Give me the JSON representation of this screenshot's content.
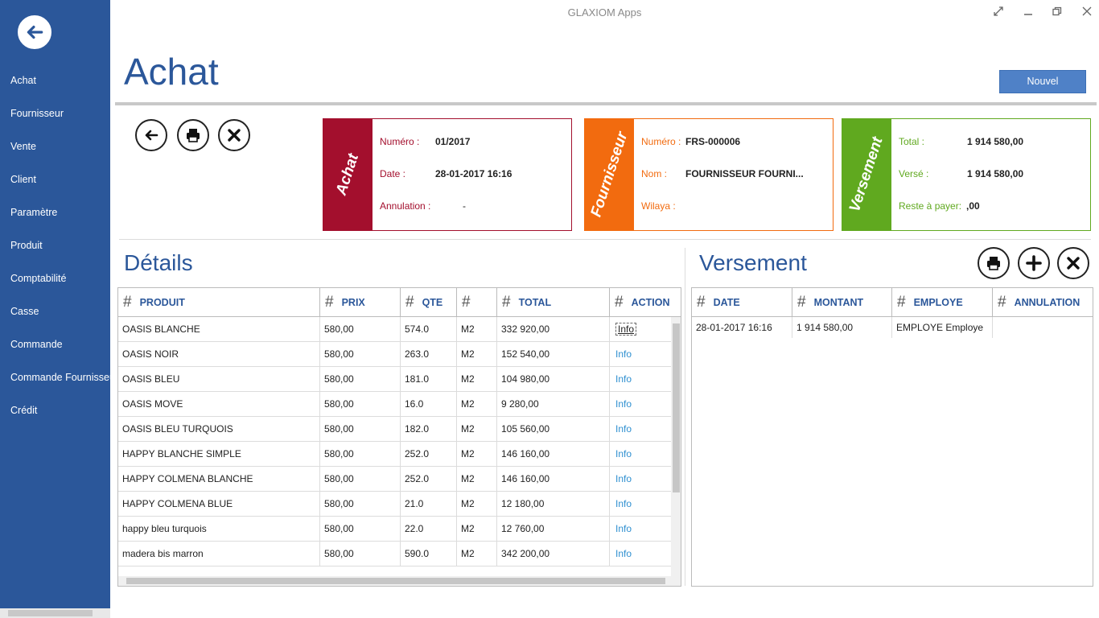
{
  "app": {
    "title": "GLAXIOM Apps"
  },
  "sidebar": {
    "items": [
      {
        "label": "Achat"
      },
      {
        "label": "Fournisseur"
      },
      {
        "label": "Vente"
      },
      {
        "label": "Client"
      },
      {
        "label": "Paramètre"
      },
      {
        "label": "Produit"
      },
      {
        "label": "Comptabilité"
      },
      {
        "label": "Casse"
      },
      {
        "label": "Commande"
      },
      {
        "label": "Commande Fournisseur"
      },
      {
        "label": "Crédit"
      }
    ]
  },
  "header": {
    "title": "Achat",
    "new_button": "Nouvel"
  },
  "cards": {
    "achat": {
      "side": "Achat",
      "numero_label": "Numéro :",
      "numero": "01/2017",
      "date_label": "Date :",
      "date": "28-01-2017 16:16",
      "annulation_label": "Annulation :",
      "annulation": "-",
      "color": "#a30f2d"
    },
    "fournisseur": {
      "side": "Fournisseur",
      "numero_label": "Numéro :",
      "numero": "FRS-000006",
      "nom_label": "Nom :",
      "nom": "FOURNISSEUR FOURNI...",
      "wilaya_label": "Wilaya :",
      "color": "#f26b0f"
    },
    "versement": {
      "side": "Versement",
      "total_label": "Total :",
      "total": "1 914 580,00",
      "verse_label": "Versé :",
      "verse": "1 914 580,00",
      "reste_label": "Reste à payer:",
      "reste": ",00",
      "color": "#60a91f"
    }
  },
  "details": {
    "title": "Détails",
    "columns": [
      "PRODUIT",
      "PRIX",
      "QTE",
      "",
      "TOTAL",
      "ACTION"
    ],
    "rows": [
      {
        "produit": "OASIS BLANCHE",
        "prix": "580,00",
        "qte": "574.0",
        "unit": "M2",
        "total": "332 920,00",
        "action": "Info"
      },
      {
        "produit": "OASIS NOIR",
        "prix": "580,00",
        "qte": "263.0",
        "unit": "M2",
        "total": "152 540,00",
        "action": "Info"
      },
      {
        "produit": "OASIS BLEU",
        "prix": "580,00",
        "qte": "181.0",
        "unit": "M2",
        "total": "104 980,00",
        "action": "Info"
      },
      {
        "produit": "OASIS MOVE",
        "prix": "580,00",
        "qte": "16.0",
        "unit": "M2",
        "total": "9 280,00",
        "action": "Info"
      },
      {
        "produit": "OASIS BLEU TURQUOIS",
        "prix": "580,00",
        "qte": "182.0",
        "unit": "M2",
        "total": "105 560,00",
        "action": "Info"
      },
      {
        "produit": "HAPPY BLANCHE SIMPLE",
        "prix": "580,00",
        "qte": "252.0",
        "unit": "M2",
        "total": "146 160,00",
        "action": "Info"
      },
      {
        "produit": "HAPPY COLMENA BLANCHE",
        "prix": "580,00",
        "qte": "252.0",
        "unit": "M2",
        "total": "146 160,00",
        "action": "Info"
      },
      {
        "produit": "HAPPY COLMENA BLUE",
        "prix": "580,00",
        "qte": "21.0",
        "unit": "M2",
        "total": "12 180,00",
        "action": "Info"
      },
      {
        "produit": "happy bleu turquois",
        "prix": "580,00",
        "qte": "22.0",
        "unit": "M2",
        "total": "12 760,00",
        "action": "Info"
      },
      {
        "produit": "madera bis marron",
        "prix": "580,00",
        "qte": "590.0",
        "unit": "M2",
        "total": "342 200,00",
        "action": "Info"
      }
    ]
  },
  "versement": {
    "title": "Versement",
    "columns": [
      "DATE",
      "MONTANT",
      "EMPLOYE",
      "ANNULATION"
    ],
    "rows": [
      {
        "date": "28-01-2017 16:16",
        "montant": "1 914 580,00",
        "employe": "EMPLOYE Employe",
        "annulation": ""
      }
    ]
  }
}
